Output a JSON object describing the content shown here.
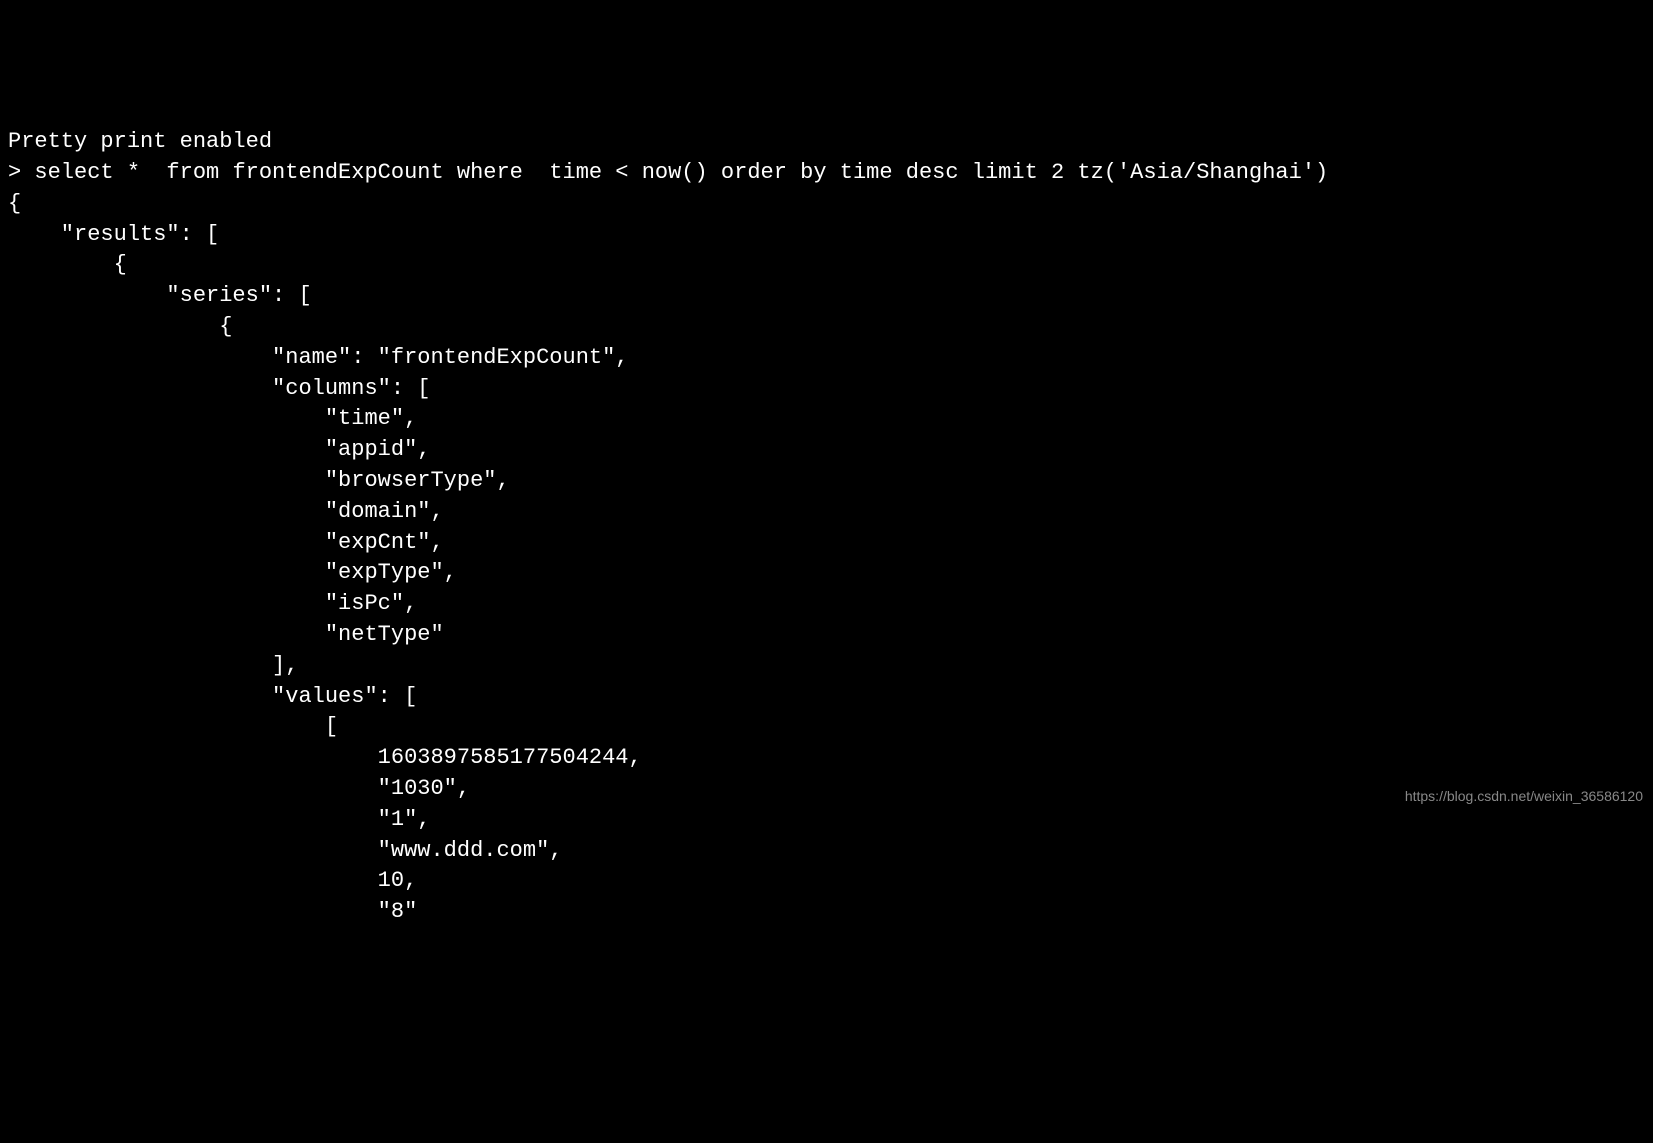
{
  "terminal": {
    "line1": "Pretty print enabled",
    "prompt": "> ",
    "query": "select *  from frontendExpCount where  time < now() order by time desc limit 2 tz('Asia/Shanghai')",
    "json_output": {
      "l1": "{",
      "l2": "    \"results\": [",
      "l3": "        {",
      "l4": "            \"series\": [",
      "l5": "                {",
      "l6": "                    \"name\": \"frontendExpCount\",",
      "l7": "                    \"columns\": [",
      "l8": "                        \"time\",",
      "l9": "                        \"appid\",",
      "l10": "                        \"browserType\",",
      "l11": "                        \"domain\",",
      "l12": "                        \"expCnt\",",
      "l13": "                        \"expType\",",
      "l14": "                        \"isPc\",",
      "l15": "                        \"netType\"",
      "l16": "                    ],",
      "l17": "                    \"values\": [",
      "l18": "                        [",
      "l19": "                            1603897585177504244,",
      "l20": "                            \"1030\",",
      "l21": "                            \"1\",",
      "l22": "                            \"www.ddd.com\",",
      "l23": "                            10,",
      "l24": "                            \"8\""
    }
  },
  "watermark": "https://blog.csdn.net/weixin_36586120"
}
